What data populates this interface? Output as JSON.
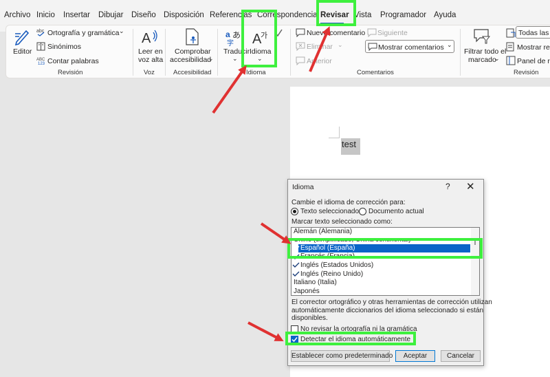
{
  "menu": {
    "tabs": [
      "Archivo",
      "Inicio",
      "Insertar",
      "Dibujar",
      "Diseño",
      "Disposición",
      "Referencias",
      "Correspondencia",
      "Revisar",
      "Vista",
      "Programador",
      "Ayuda"
    ],
    "active": "Revisar"
  },
  "ribbon": {
    "revision": {
      "editor": "Editor",
      "ortografia": "Ortografía y gramática",
      "sinonimos": "Sinónimos",
      "contar": "Contar palabras",
      "group": "Revisión"
    },
    "voz": {
      "leer_1": "Leer en",
      "leer_2": "voz alta",
      "group": "Voz"
    },
    "accesibilidad": {
      "comprobar_1": "Comprobar",
      "comprobar_2": "accesibilidad",
      "group": "Accesibilidad"
    },
    "idioma": {
      "traducir": "Traducir",
      "idioma": "Idioma",
      "group": "Idioma"
    },
    "comentarios": {
      "nuevo": "Nuevo comentario",
      "eliminar": "Eliminar",
      "anterior": "Anterior",
      "siguiente": "Siguiente",
      "mostrar": "Mostrar comentarios",
      "group": "Comentarios"
    },
    "seguimiento": {
      "filtrar_1": "Filtrar todo el",
      "filtrar_2": "marcado",
      "todas": "Todas las re",
      "mostrar_rev": "Mostrar revi",
      "panel": "Panel de rev",
      "group": "Revisión"
    }
  },
  "document": {
    "text": "test"
  },
  "dialog": {
    "title": "Idioma",
    "help": "?",
    "close": "✕",
    "change_label": "Cambie el idioma de corrección para:",
    "radio_selected": "Texto seleccionado",
    "radio_document": "Documento actual",
    "mark_label": "Marcar texto seleccionado como:",
    "languages": [
      {
        "name": "Alemán (Alemania)",
        "check": false
      },
      {
        "name": "Chino (simplificado, China continental)",
        "check": false
      },
      {
        "name": "Español (España)",
        "check": true
      },
      {
        "name": "Francés (Francia)",
        "check": true
      },
      {
        "name": "Inglés (Estados Unidos)",
        "check": true
      },
      {
        "name": "Inglés (Reino Unido)",
        "check": true
      },
      {
        "name": "Italiano (Italia)",
        "check": false
      },
      {
        "name": "Japonés",
        "check": false
      }
    ],
    "selected_language": "Español (España)",
    "info_1": "El corrector ortográfico y otras herramientas de corrección utilizan",
    "info_2": "automáticamente diccionarios del idioma seleccionado si están",
    "info_3": "disponibles.",
    "no_revisar": "No revisar la ortografía ni la gramática",
    "no_revisar_checked": false,
    "detectar": "Detectar el idioma automáticamente",
    "detectar_checked": true,
    "btn_default": "Establecer como predeterminado",
    "btn_ok": "Aceptar",
    "btn_cancel": "Cancelar"
  },
  "colors": {
    "highlight": "#3ef03e",
    "arrow": "#e03131",
    "selection": "#0a64c8",
    "accent": "#185abd"
  }
}
